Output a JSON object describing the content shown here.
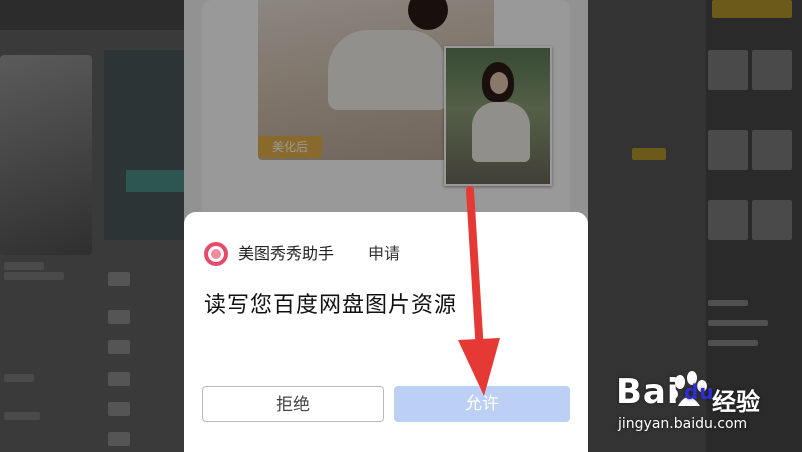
{
  "dialog": {
    "app_name": "美图秀秀助手",
    "action": "申请",
    "request": "读写您百度网盘图片资源",
    "reject_label": "拒绝",
    "allow_label": "允许",
    "app_icon": "meitu-app-icon"
  },
  "background": {
    "tag_after": "美化后"
  },
  "watermark": {
    "logo_left": "Bai",
    "logo_right": "du",
    "subtitle": "经验",
    "url": "jingyan.baidu.com"
  },
  "colors": {
    "allow_button": "#bcd0f6",
    "arrow": "#e53935",
    "app_icon": "#e64b6b",
    "tag": "#e7b14a"
  }
}
